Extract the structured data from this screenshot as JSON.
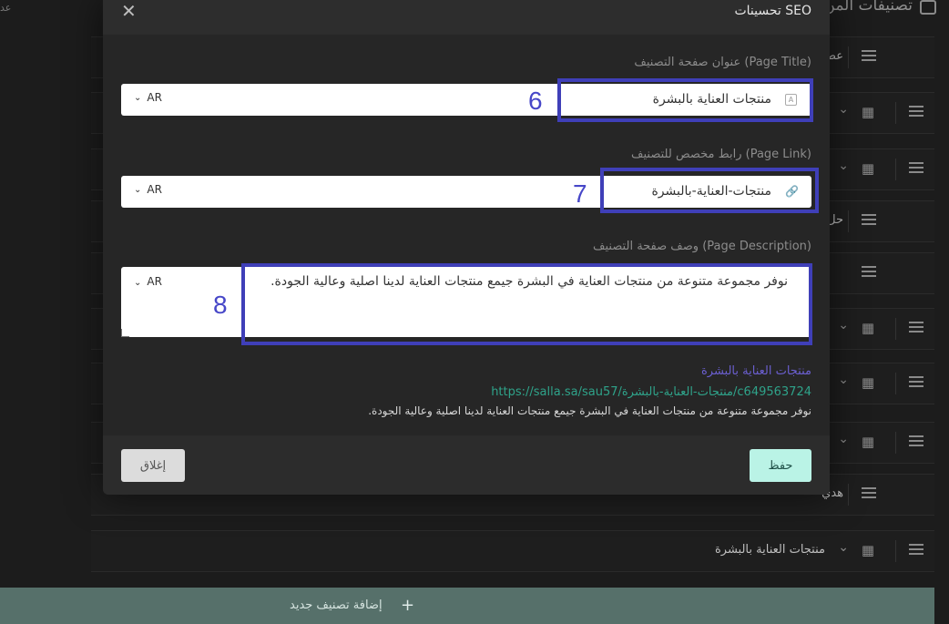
{
  "background": {
    "page_title": "تصنيفات المن",
    "left_word": "عد",
    "rows": [
      {
        "label": "عط",
        "chevron": false
      },
      {
        "label": "",
        "chevron": true
      },
      {
        "label": "",
        "chevron": true
      },
      {
        "label": "حل",
        "chevron": false
      },
      {
        "label": "",
        "chevron": false
      },
      {
        "label": "",
        "chevron": true
      },
      {
        "label": "",
        "chevron": true
      },
      {
        "label": "",
        "chevron": true
      },
      {
        "label": "هدي",
        "chevron": false
      },
      {
        "label": "منتجات العناية بالبشرة",
        "chevron": true
      }
    ],
    "add_category_label": "إضافة تصنيف جديد",
    "add_icon": "plus-icon"
  },
  "modal": {
    "title": "تحسينات SEO",
    "close_icon": "close-icon",
    "page_title_field": {
      "label": "عنوان صفحة التصنيف (Page Title)",
      "value": "منتجات العناية بالبشرة",
      "lang": "AR",
      "annotation": "6"
    },
    "page_link_field": {
      "label": "رابط مخصص للتصنيف (Page Link)",
      "value": "منتجات-العناية-بالبشرة",
      "lang": "AR",
      "annotation": "7"
    },
    "page_description_field": {
      "label": "وصف صفحة التصنيف (Page Description)",
      "value": "نوفر مجموعة متنوعة من منتجات العناية في البشرة جيمع منتجات العناية لدينا اصلية وعالية الجودة.",
      "lang": "AR",
      "annotation": "8"
    },
    "preview": {
      "title": "منتجات العناية بالبشرة",
      "url": "https://salla.sa/sau57/منتجات-العناية-بالبشرة/c649563724",
      "description": "نوفر مجموعة متنوعة من منتجات العناية في البشرة جيمع منتجات العناية لدينا اصلية وعالية الجودة."
    },
    "save_label": "حفظ",
    "close_label": "إغلاق"
  },
  "colors": {
    "highlight": "#3f3fb8",
    "save_button": "#baf3e6",
    "preview_title": "#6b5fd0",
    "preview_url": "#2fa38a"
  }
}
